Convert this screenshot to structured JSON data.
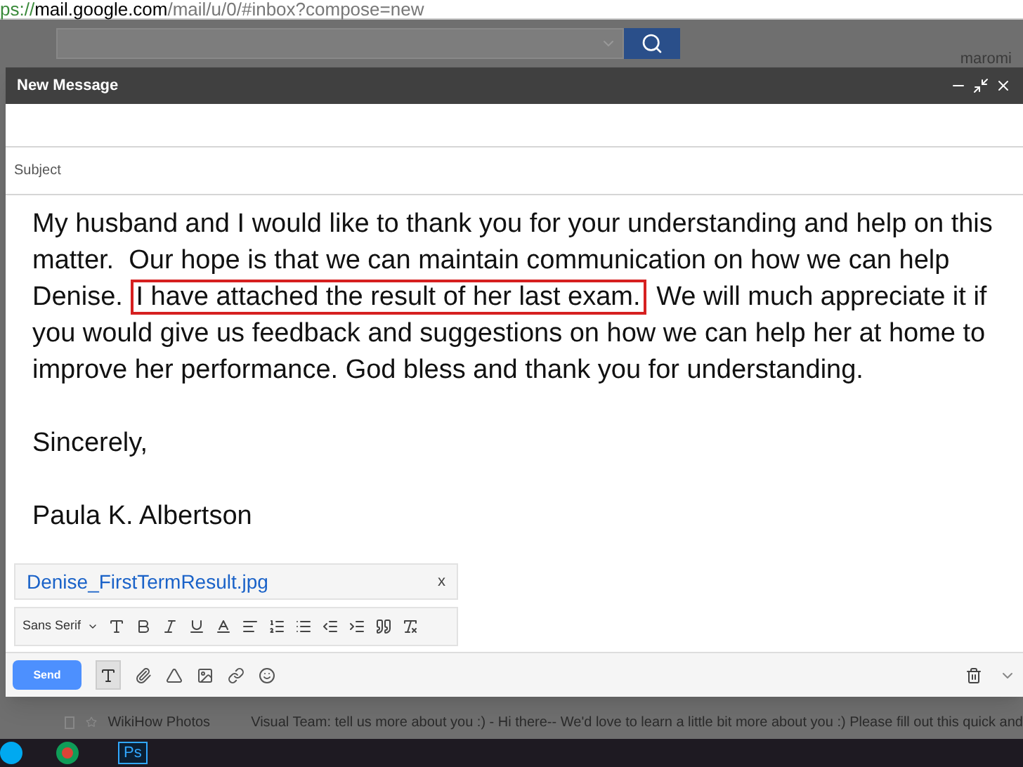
{
  "address_bar": {
    "url_prefix": "ps://",
    "url_host": "mail.google.com",
    "url_path": "/mail/u/0/#inbox?compose=new"
  },
  "header": {
    "user": "maromi"
  },
  "compose": {
    "title": "New Message",
    "subject_placeholder": "Subject",
    "paragraph": {
      "before": "My husband and I would like to thank you for your understanding and help on this matter.  Our hope is that we can maintain communication on how we can help Denise. ",
      "highlight": "I have attached the result of her last exam.",
      "after": " We will much appreciate it if you would give us feedback and suggestions on how we can help her at home to improve her performance. God bless and thank you for understanding."
    },
    "closing": "Sincerely,",
    "signature": "Paula K. Albertson",
    "attachment": {
      "name": "Denise_FirstTermResult.jpg",
      "remove": "x"
    },
    "format_bar": {
      "font": "Sans Serif"
    },
    "send": "Send"
  },
  "inbox_row": {
    "checked": false,
    "sender": "WikiHow Photos",
    "snippet": "Visual Team: tell us more about you :) - Hi there-- We'd love to learn a little bit more about you :) Please fill out this quick and"
  },
  "taskbar": {
    "apps": [
      {
        "kind": "skype"
      },
      {
        "kind": "chrome"
      },
      {
        "kind": "text",
        "label": "Ps"
      }
    ]
  }
}
